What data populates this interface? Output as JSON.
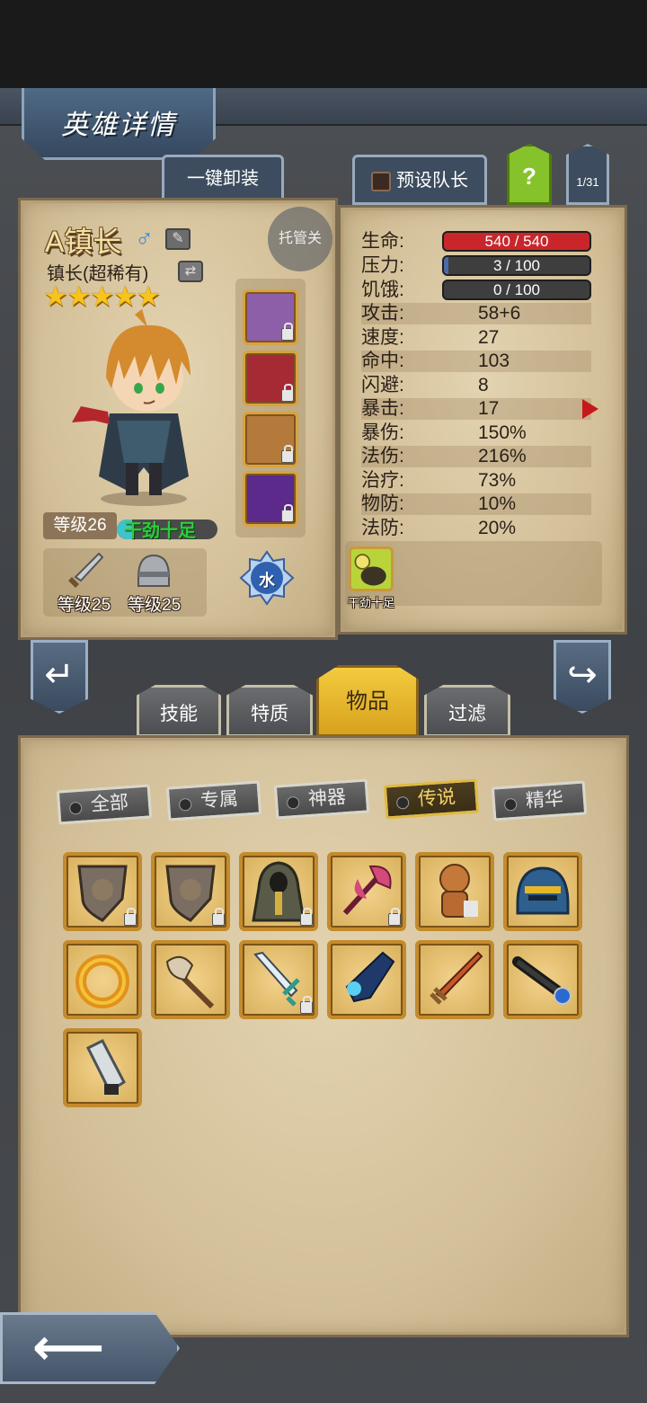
{
  "header": {
    "title": "英雄详情"
  },
  "top_buttons": {
    "unequip_all": "一键卸装",
    "preset_leader": "预设队长",
    "help": "?",
    "page": "1/31"
  },
  "hero": {
    "name": "A镇长",
    "gender_symbol": "♂",
    "auto_label": "托管关",
    "class_label": "镇长(超稀有)",
    "stars": 5,
    "stars_text": "★★★★★",
    "level": "等级26",
    "mood": "干劲十足",
    "mood_level": 0.15,
    "element": "水",
    "weapon_level": "等级25",
    "armor_level": "等级25",
    "equipment_icons": [
      "wizard-hat-icon",
      "red-tome-icon",
      "treasure-chest-icon",
      "crystal-staff-icon"
    ]
  },
  "stats": {
    "hp": {
      "label": "生命:",
      "value": "540 / 540",
      "current": 540,
      "max": 540,
      "color": "#c8262b"
    },
    "stress": {
      "label": "压力:",
      "value": "3 / 100",
      "current": 3,
      "max": 100,
      "color": "#4a6aa8"
    },
    "hunger": {
      "label": "饥饿:",
      "value": "0 / 100",
      "current": 0,
      "max": 100,
      "color": "#4a6aa8"
    },
    "rows": [
      {
        "label": "攻击:",
        "value": "58+6"
      },
      {
        "label": "速度:",
        "value": "27"
      },
      {
        "label": "命中:",
        "value": "103"
      },
      {
        "label": "闪避:",
        "value": "8"
      },
      {
        "label": "暴击:",
        "value": "17"
      },
      {
        "label": "暴伤:",
        "value": "150%"
      },
      {
        "label": "法伤:",
        "value": "216%"
      },
      {
        "label": "治疗:",
        "value": "73%"
      },
      {
        "label": "物防:",
        "value": "10%"
      },
      {
        "label": "法防:",
        "value": "20%"
      }
    ],
    "trait_label": "干劲十足"
  },
  "tabs": [
    {
      "label": "技能",
      "active": false
    },
    {
      "label": "特质",
      "active": false
    },
    {
      "label": "物品",
      "active": true
    },
    {
      "label": "过滤",
      "active": false
    }
  ],
  "filters": [
    {
      "label": "全部",
      "active": false
    },
    {
      "label": "专属",
      "active": false
    },
    {
      "label": "神器",
      "active": false
    },
    {
      "label": "传说",
      "active": true
    },
    {
      "label": "精华",
      "active": false
    }
  ],
  "items": [
    {
      "icon": "lion-shield-icon",
      "locked": true
    },
    {
      "icon": "lion-shield-icon",
      "locked": true
    },
    {
      "icon": "hooded-cloak-icon",
      "locked": true
    },
    {
      "icon": "heart-axe-icon",
      "locked": true
    },
    {
      "icon": "voodoo-doll-icon",
      "locked": false
    },
    {
      "icon": "knight-helmet-icon",
      "locked": false
    },
    {
      "icon": "dragon-ring-icon",
      "locked": false
    },
    {
      "icon": "dragon-skull-staff-icon",
      "locked": false
    },
    {
      "icon": "lightning-sword-icon",
      "locked": true
    },
    {
      "icon": "blue-gauntlet-icon",
      "locked": false
    },
    {
      "icon": "flame-sword-icon",
      "locked": false
    },
    {
      "icon": "spyglass-icon",
      "locked": false
    },
    {
      "icon": "potion-bottle-icon",
      "locked": false
    }
  ]
}
